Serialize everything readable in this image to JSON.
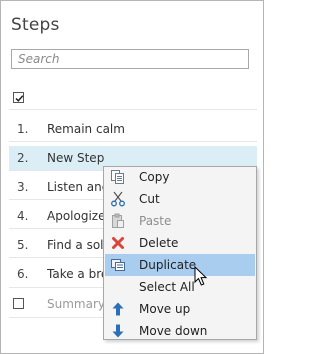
{
  "panel": {
    "title": "Steps"
  },
  "search": {
    "placeholder": "Search"
  },
  "select_all_checked": true,
  "steps": [
    {
      "num": "1.",
      "label": "Remain calm"
    },
    {
      "num": "2.",
      "label": "New Step",
      "selected": true
    },
    {
      "num": "3.",
      "label": "Listen and"
    },
    {
      "num": "4.",
      "label": "Apologize"
    },
    {
      "num": "5.",
      "label": "Find a sol"
    },
    {
      "num": "6.",
      "label": "Take a bre"
    }
  ],
  "summary_row": {
    "placeholder": "Summary"
  },
  "context_menu": {
    "items": [
      {
        "label": "Copy",
        "icon": "copy-icon",
        "enabled": true
      },
      {
        "label": "Cut",
        "icon": "cut-icon",
        "enabled": true
      },
      {
        "label": "Paste",
        "icon": "paste-icon",
        "enabled": false
      },
      {
        "label": "Delete",
        "icon": "delete-icon",
        "enabled": true
      },
      {
        "label": "Duplicate",
        "icon": "duplicate-icon",
        "enabled": true,
        "highlighted": true
      },
      {
        "label": "Select All",
        "icon": "",
        "enabled": true
      },
      {
        "label": "Move up",
        "icon": "arrow-up-icon",
        "enabled": true
      },
      {
        "label": "Move down",
        "icon": "arrow-down-icon",
        "enabled": true
      }
    ]
  },
  "colors": {
    "selected_row": "#dbeef6",
    "menu_highlight": "#a9cdef",
    "arrow_blue": "#2a6fb8",
    "delete_red": "#d9453c"
  }
}
